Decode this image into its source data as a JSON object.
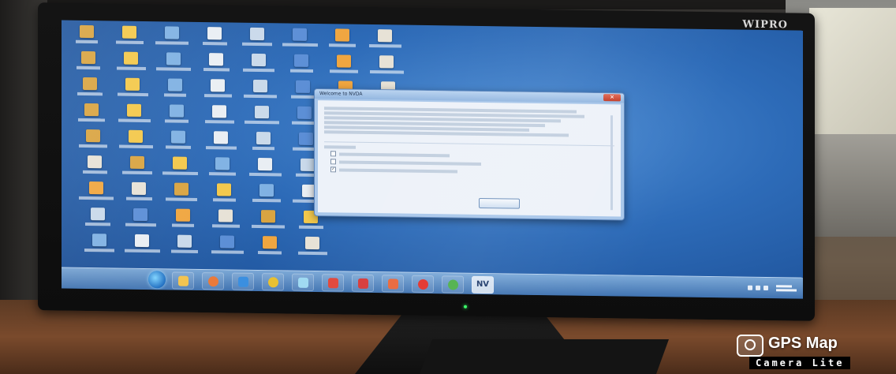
{
  "monitor": {
    "brand": "WIPRO"
  },
  "dialog": {
    "title": "Welcome to NVDA",
    "close_icon": "close-icon"
  },
  "watermark": {
    "title": "GPS Map",
    "subtitle": "Camera Lite",
    "icon": "camera-icon"
  },
  "desktop": {
    "icon_colors": [
      "#d9a441",
      "#f3c84a",
      "#7fb1e3",
      "#e9eef3",
      "#c9d9ea",
      "#5b8ed6",
      "#f0a640",
      "#e7e2d6"
    ]
  },
  "taskbar": {
    "pinned_icons": [
      "start-icon",
      "file-explorer-icon",
      "media-player-icon",
      "internet-explorer-icon",
      "chrome-icon",
      "paint-icon",
      "app-icon",
      "app-icon",
      "app-icon",
      "opera-icon",
      "chrome-icon",
      "nvda-icon"
    ],
    "pinned_colors": [
      "#ffffff",
      "#f2c34e",
      "#e9793a",
      "#3b8fe0",
      "#e8c02f",
      "#9fd9f2",
      "#e0463a",
      "#d63a3a",
      "#e9673a",
      "#e2322b",
      "#4db04a",
      "#2b4b8a"
    ],
    "nvda_label": "NV"
  }
}
